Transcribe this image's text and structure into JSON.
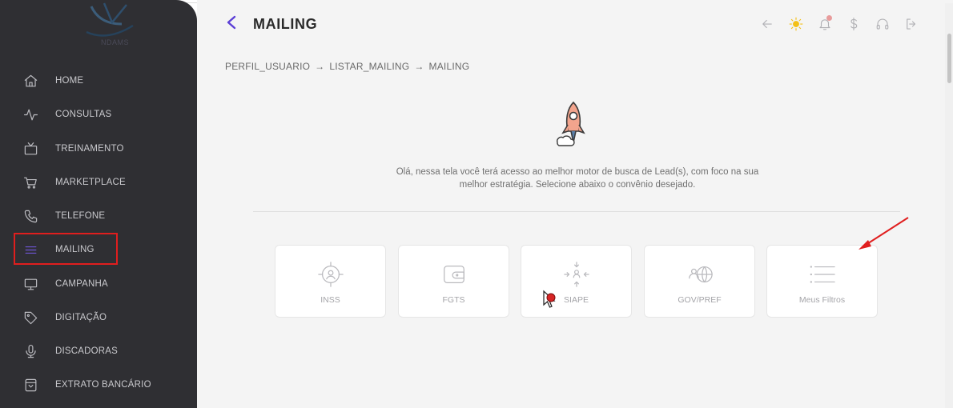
{
  "brand": {
    "logo_text": "NDAMS"
  },
  "sidebar": {
    "items": [
      {
        "label": "HOME",
        "icon": "home-icon"
      },
      {
        "label": "CONSULTAS",
        "icon": "activity-icon"
      },
      {
        "label": "TREINAMENTO",
        "icon": "tv-icon"
      },
      {
        "label": "MARKETPLACE",
        "icon": "cart-icon"
      },
      {
        "label": "TELEFONE",
        "icon": "phone-icon"
      },
      {
        "label": "MAILING",
        "icon": "list-icon",
        "active": true
      },
      {
        "label": "CAMPANHA",
        "icon": "monitor-icon"
      },
      {
        "label": "DIGITAÇÃO",
        "icon": "tag-icon"
      },
      {
        "label": "DISCADORAS",
        "icon": "mic-icon"
      },
      {
        "label": "EXTRATO BANCÁRIO",
        "icon": "receipt-icon"
      }
    ]
  },
  "header": {
    "title": "MAILING",
    "icons": [
      "arrow-left-icon",
      "sun-icon",
      "bell-icon",
      "dollar-icon",
      "headset-icon",
      "logout-icon"
    ]
  },
  "breadcrumb": {
    "items": [
      "PERFIL_USUARIO",
      "LISTAR_MAILING",
      "MAILING"
    ],
    "separator": "→"
  },
  "main": {
    "intro": "Olá, nessa tela você terá acesso ao melhor motor de busca de Lead(s), com foco na sua melhor estratégia. Selecione abaixo o convênio desejado.",
    "cards": [
      {
        "label": "INSS",
        "icon": "target-user-icon"
      },
      {
        "label": "FGTS",
        "icon": "wallet-icon"
      },
      {
        "label": "SIAPE",
        "icon": "converge-user-icon"
      },
      {
        "label": "GOV/PREF",
        "icon": "user-globe-icon"
      },
      {
        "label": "Meus Filtros",
        "icon": "list-filter-icon"
      }
    ]
  },
  "colors": {
    "sidebar_bg": "#2f2f33",
    "accent": "#5b3fd6",
    "highlight_box": "#e01e1e",
    "sun": "#f3c016"
  }
}
